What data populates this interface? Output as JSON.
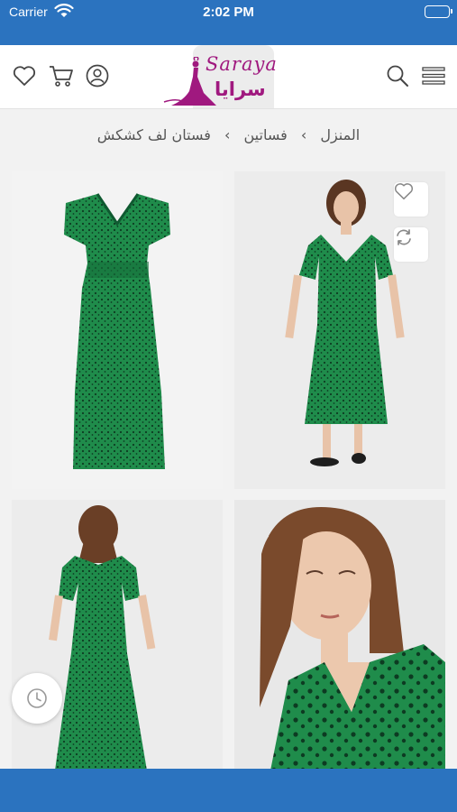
{
  "status_bar": {
    "carrier": "Carrier",
    "time": "2:02 PM",
    "icons": [
      "wifi-icon",
      "battery-icon"
    ]
  },
  "header": {
    "logo": {
      "latin": "Saraya",
      "arabic": "سرايا"
    },
    "icons": [
      "heart-icon",
      "cart-icon",
      "user-icon",
      "search-icon",
      "menu-icon"
    ]
  },
  "breadcrumb": {
    "items": [
      "المنزل",
      "فساتين",
      "فستان لف كشكش"
    ],
    "separator": "›"
  },
  "gallery": {
    "images": [
      {
        "name": "dress-front-image",
        "subject": "green polka-dot maxi dress, flat product shot"
      },
      {
        "name": "dress-model-front-image",
        "subject": "model wearing the green dress, front view"
      },
      {
        "name": "dress-model-back-image",
        "subject": "model wearing the green dress, back view"
      },
      {
        "name": "dress-model-closeup-image",
        "subject": "close-up portrait of model in the green dress"
      }
    ],
    "actions": [
      "heart-icon",
      "compare-icon"
    ]
  },
  "floating": {
    "icon": "clock-icon"
  },
  "colors": {
    "brand_blue": "#2b73bf",
    "logo_magenta": "#a0197f",
    "dress_green": "#1e8a4a",
    "background": "#f2f2f2"
  }
}
